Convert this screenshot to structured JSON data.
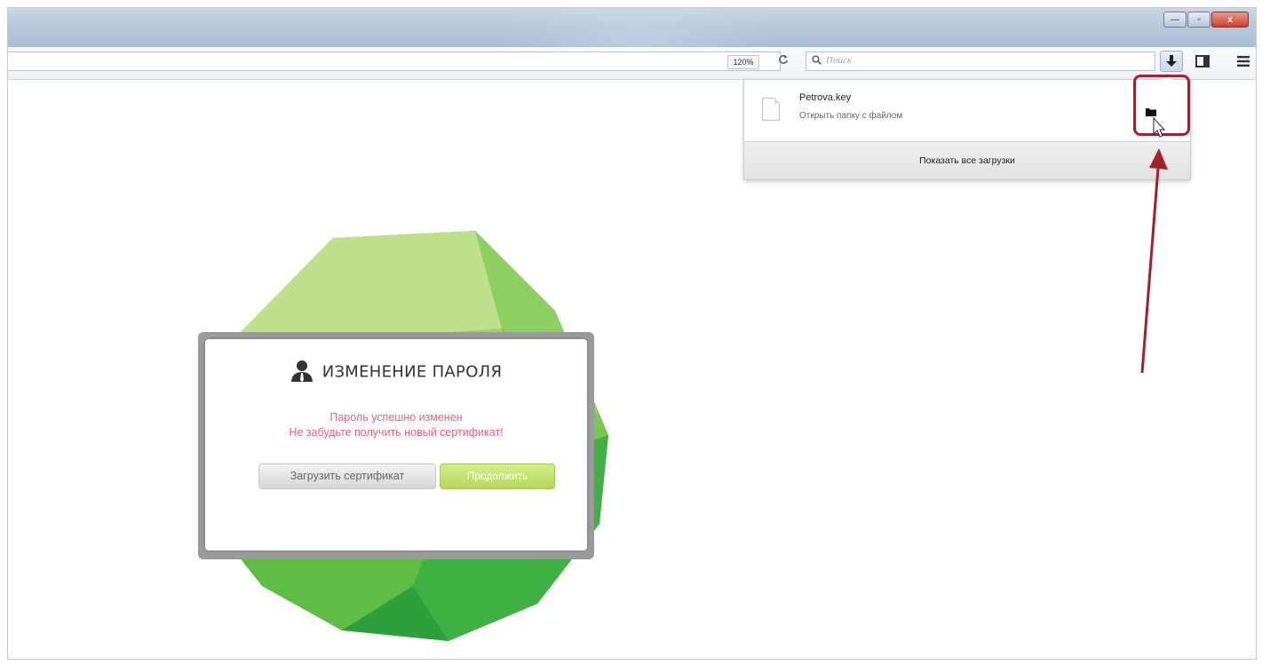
{
  "browser": {
    "window_buttons": {
      "minimize": "—",
      "restore": "▫",
      "close": "x"
    },
    "zoom_level": "120%",
    "reload_glyph": "C",
    "search": {
      "placeholder": "Поиск"
    },
    "toolbar": {
      "downloads_icon": "download-arrow-icon",
      "sidebar_icon": "sidebar-icon",
      "menu_icon": "hamburger-icon"
    }
  },
  "downloads_panel": {
    "file_name": "Petrova.key",
    "file_action": "Открыть папку с файлом",
    "show_all_label": "Показать все загрузки"
  },
  "dialog": {
    "title": "ИЗМЕНЕНИЕ ПАРОЛЯ",
    "message_line1": "Пароль успешно изменен",
    "message_line2": "Не забудьте получить новый сертификат!",
    "upload_button": "Загрузить сертификат",
    "continue_button": "Продолжить"
  },
  "colors": {
    "annotation": "#a3212c",
    "message": "#f1607c",
    "continue_button": "#b3d75b"
  }
}
